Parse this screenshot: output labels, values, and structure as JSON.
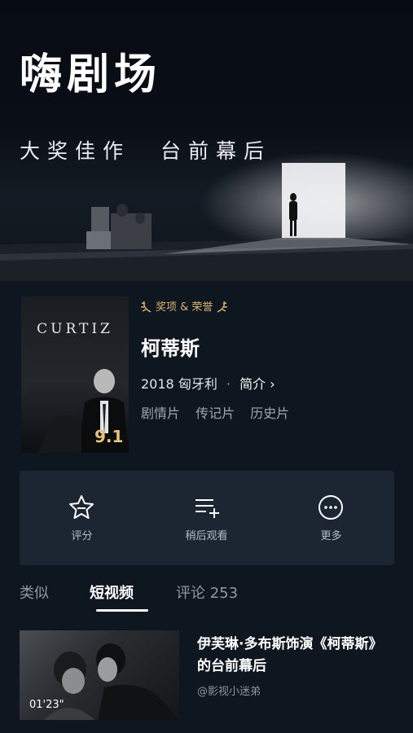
{
  "hero": {
    "title": "嗨剧场",
    "subtitle_left": "大奖佳作",
    "subtitle_right": "台前幕后"
  },
  "movie": {
    "poster_title": "CURTIZ",
    "poster_score": "9.1",
    "award_label": "奖项 & 荣誉",
    "title": "柯蒂斯",
    "year": "2018",
    "country": "匈牙利",
    "separator": "·",
    "intro_label": "简介 ›",
    "genres": [
      "剧情片",
      "传记片",
      "历史片"
    ]
  },
  "actions": [
    {
      "label": "评分",
      "icon": "star-minus-icon"
    },
    {
      "label": "稍后观看",
      "icon": "playlist-add-icon"
    },
    {
      "label": "更多",
      "icon": "more-circle-icon"
    }
  ],
  "tabs": [
    {
      "label": "类似",
      "active": false
    },
    {
      "label": "短视频",
      "active": true
    },
    {
      "label": "评论 253",
      "active": false
    }
  ],
  "video": {
    "duration": "01'23\"",
    "title": "伊芙琳·多布斯饰演《柯蒂斯》的台前幕后",
    "author": "@影视小迷弟"
  },
  "colors": {
    "background": "#0e1620",
    "panel": "#1b2632",
    "award_gold": "#d9b271",
    "score_gold": "#e6c27a"
  }
}
